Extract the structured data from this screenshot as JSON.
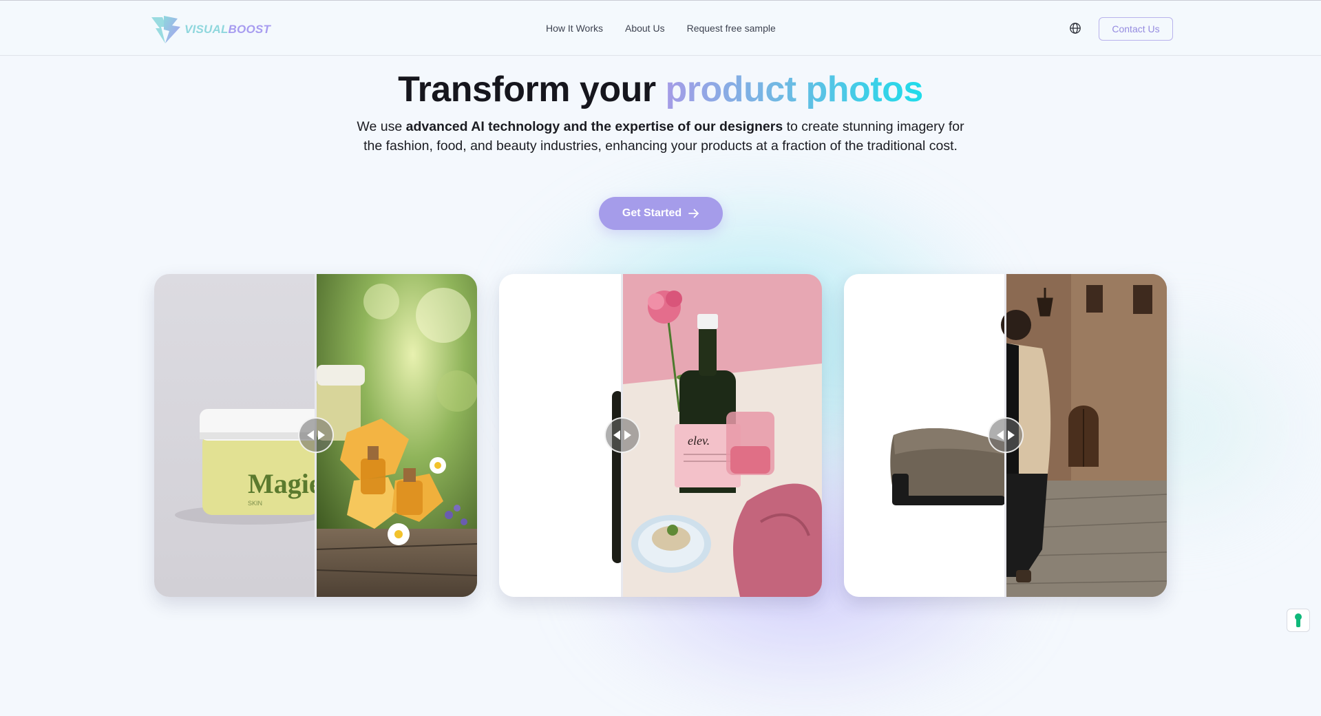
{
  "header": {
    "logo": {
      "part1": "VISUAL",
      "part2": "BOOST",
      "icon": "lightning-bolt-icon"
    },
    "nav": [
      {
        "label": "How It Works"
      },
      {
        "label": "About Us"
      },
      {
        "label": "Request free sample"
      }
    ],
    "language_icon": "globe-icon",
    "contact_label": "Contact Us"
  },
  "hero": {
    "title_plain": "Transform your ",
    "title_highlight": "product photos",
    "subtitle_pre": "We use ",
    "subtitle_bold": "advanced AI technology and the expertise of our designers",
    "subtitle_post": " to create stunning imagery for the fashion, food, and beauty industries, enhancing your products at a fraction of the traditional cost.",
    "cta_label": "Get Started",
    "cta_icon": "arrow-right-icon"
  },
  "comparisons": [
    {
      "product": "skincare jar",
      "product_label": "Magie",
      "product_sublabel": "SKIN",
      "handle_icon": "drag-left-right-icon"
    },
    {
      "product": "olive oil bottle",
      "product_label": "elev.",
      "handle_icon": "drag-left-right-icon"
    },
    {
      "product": "loafer shoe",
      "handle_icon": "drag-left-right-icon"
    }
  ],
  "widget_icon": "accessibility-keyhole-icon",
  "colors": {
    "accent": "#a59cea",
    "accent_cyan": "#1fdcea",
    "background": "#f4f8fd",
    "text": "#16161d"
  }
}
